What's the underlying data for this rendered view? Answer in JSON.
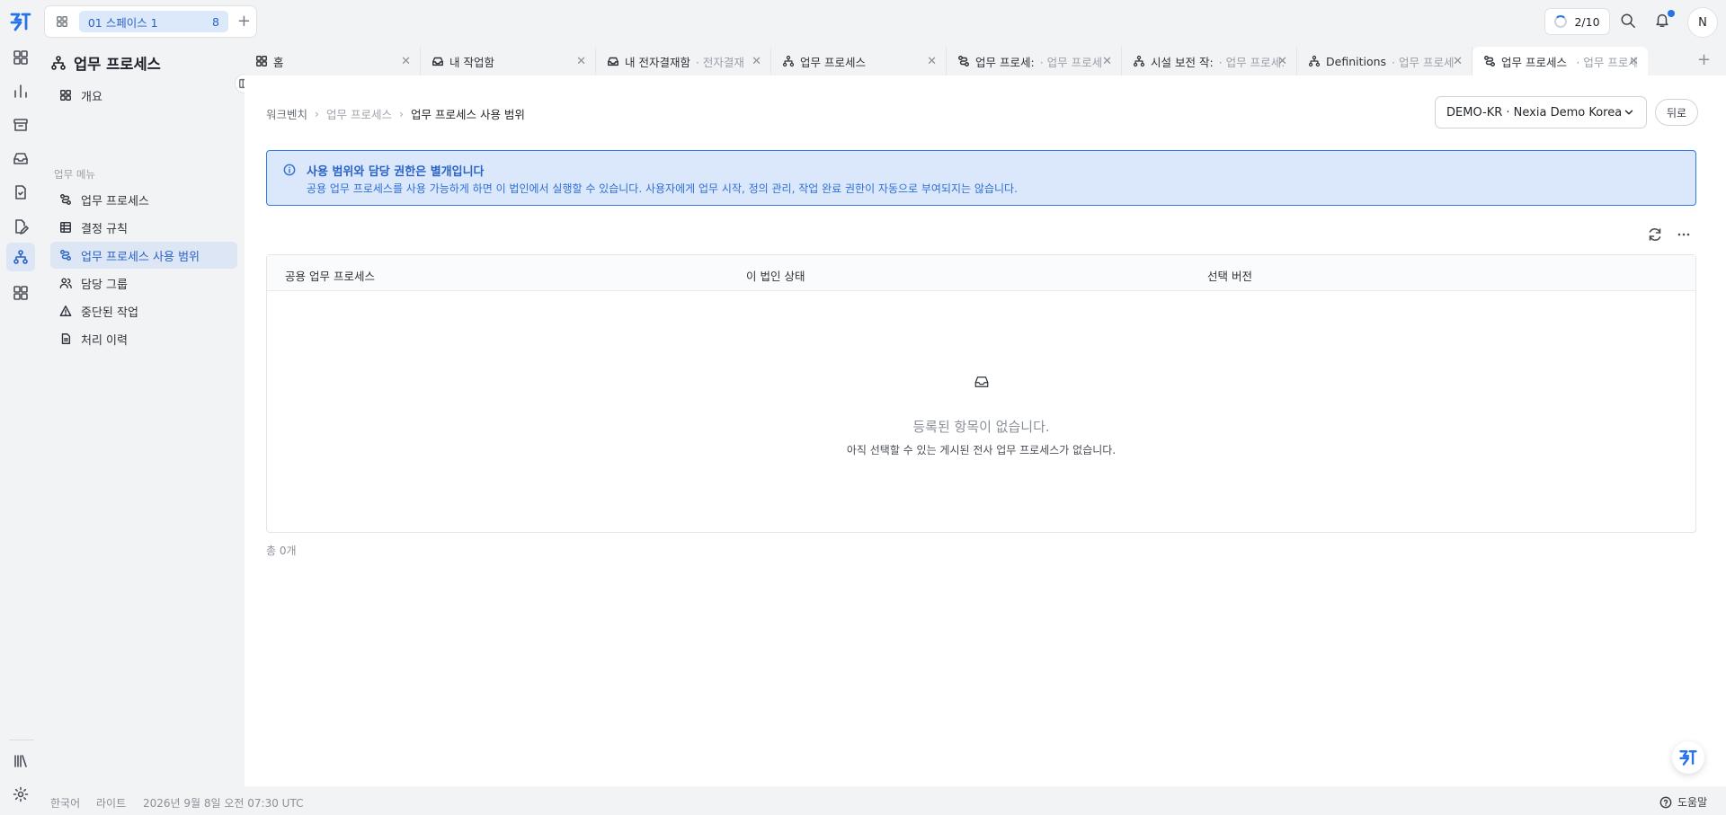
{
  "topbar": {
    "space_label": "01 스페이스 1",
    "space_count": "8",
    "progress": "2/10",
    "avatar_initial": "N"
  },
  "sidebar": {
    "title": "업무 프로세스",
    "overview": "개요",
    "group_label": "업무 메뉴",
    "items": [
      {
        "label": "업무 프로세스",
        "icon": "workflow-icon"
      },
      {
        "label": "결정 규칙",
        "icon": "table-icon"
      },
      {
        "label": "업무 프로세스 사용 범위",
        "icon": "workflow-icon",
        "active": true
      },
      {
        "label": "담당 그룹",
        "icon": "users-icon"
      },
      {
        "label": "중단된 작업",
        "icon": "alert-triangle-icon"
      },
      {
        "label": "처리 이력",
        "icon": "file-icon"
      }
    ]
  },
  "tabs": [
    {
      "label": "홈",
      "sub": ""
    },
    {
      "label": "내 작업함",
      "sub": ""
    },
    {
      "label": "내 전자결재함",
      "sub": "· 전자결재"
    },
    {
      "label": "업무 프로세스",
      "sub": ""
    },
    {
      "label": "업무 프로세:",
      "sub": "· 업무 프로세"
    },
    {
      "label": "시설 보전 작:",
      "sub": "· 업무 프로세:"
    },
    {
      "label": "Definitions",
      "sub": "· 업무 프로세"
    },
    {
      "label": "업무 프로세스 사:",
      "sub": "· 업무 프로세스"
    }
  ],
  "breadcrumb": {
    "root": "워크벤치",
    "mid": "업무 프로세스",
    "current": "업무 프로세스 사용 범위"
  },
  "entity_select": "DEMO-KR · Nexia Demo Korea",
  "back_label": "뒤로",
  "info": {
    "title": "사용 범위와 담당 권한은 별개입니다",
    "body": "공용 업무 프로세스를 사용 가능하게 하면 이 법인에서 실행할 수 있습니다. 사용자에게 업무 시작, 정의 관리, 작업 완료 권한이 자동으로 부여되지는 않습니다."
  },
  "table": {
    "columns": [
      "공용 업무 프로세스",
      "이 법인 상태",
      "선택 버전"
    ],
    "empty_title": "등록된 항목이 없습니다.",
    "empty_body": "아직 선택할 수 있는 게시된 전사 업무 프로세스가 없습니다."
  },
  "total": "총 0개",
  "footer": {
    "language": "한국어",
    "theme": "라이트",
    "datetime": "2026년 9월 8일 오전 07:30 UTC",
    "help": "도움말"
  }
}
